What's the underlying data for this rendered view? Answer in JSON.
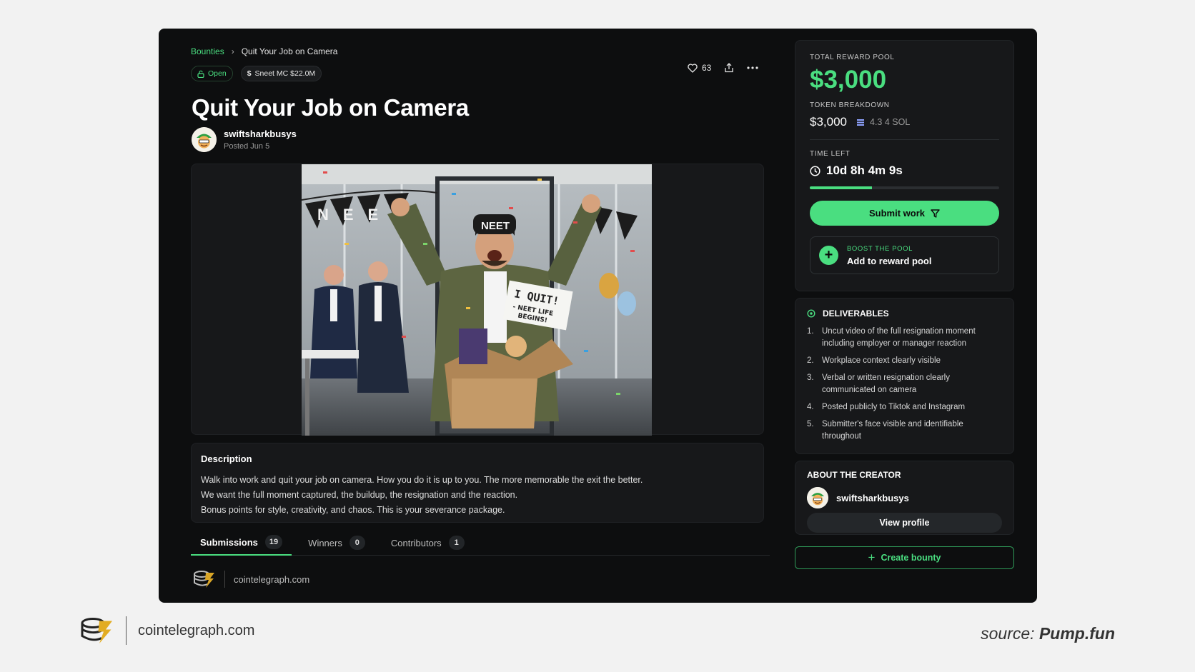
{
  "breadcrumb": {
    "root": "Bounties",
    "current": "Quit Your Job on Camera"
  },
  "badges": {
    "status": "Open",
    "market_cap": "Sneet MC $22.0M"
  },
  "actions": {
    "likes": "63"
  },
  "bounty": {
    "title": "Quit Your Job on Camera",
    "author": "swiftsharkbusys",
    "posted": "Posted Jun 5",
    "image_text": {
      "banner": "NEET",
      "cap": "NEET",
      "sign_line1": "I QUIT!",
      "sign_line2": "- NEET LIFE",
      "sign_line3": "BEGINS!"
    }
  },
  "description": {
    "title": "Description",
    "lines": [
      "Walk into work and quit your job on camera. How you do it is up to you. The more memorable the exit the better.",
      "We want the full moment captured, the buildup, the resignation and the reaction.",
      "Bonus points for style, creativity, and chaos. This is your severance package."
    ]
  },
  "tabs": [
    {
      "label": "Submissions",
      "count": "19"
    },
    {
      "label": "Winners",
      "count": "0"
    },
    {
      "label": "Contributors",
      "count": "1"
    }
  ],
  "inner_source": "cointelegraph.com",
  "reward": {
    "pool_label": "TOTAL REWARD POOL",
    "amount": "$3,000",
    "breakdown_label": "TOKEN BREAKDOWN",
    "breakdown_usd": "$3,000",
    "breakdown_sol": "4.3 4 SOL",
    "time_label": "TIME LEFT",
    "time_left": "10d 8h 4m 9s",
    "time_progress": 0.33,
    "submit_label": "Submit work",
    "boost_label": "BOOST THE POOL",
    "boost_text": "Add to reward pool"
  },
  "deliverables": {
    "title": "DELIVERABLES",
    "items": [
      {
        "n": "1.",
        "text": "Uncut video of the full resignation moment including employer or manager reaction"
      },
      {
        "n": "2.",
        "text": "Workplace context clearly visible"
      },
      {
        "n": "3.",
        "text": "Verbal or written resignation clearly communicated on camera"
      },
      {
        "n": "4.",
        "text": "Posted publicly to Tiktok and Instagram"
      },
      {
        "n": "5.",
        "text": "Submitter's face visible and identifiable throughout"
      }
    ]
  },
  "creator": {
    "title": "ABOUT THE CREATOR",
    "name": "swiftsharkbusys",
    "view_label": "View profile"
  },
  "create_bounty_label": "Create bounty",
  "footer": {
    "brand": "cointelegraph.com",
    "source_prefix": "source:",
    "source_name": "Pump.fun"
  },
  "colors": {
    "accent": "#4ade80",
    "frame_bg": "#0d0e0f",
    "card_bg": "#17181a",
    "page_bg": "#f2f2f2"
  }
}
